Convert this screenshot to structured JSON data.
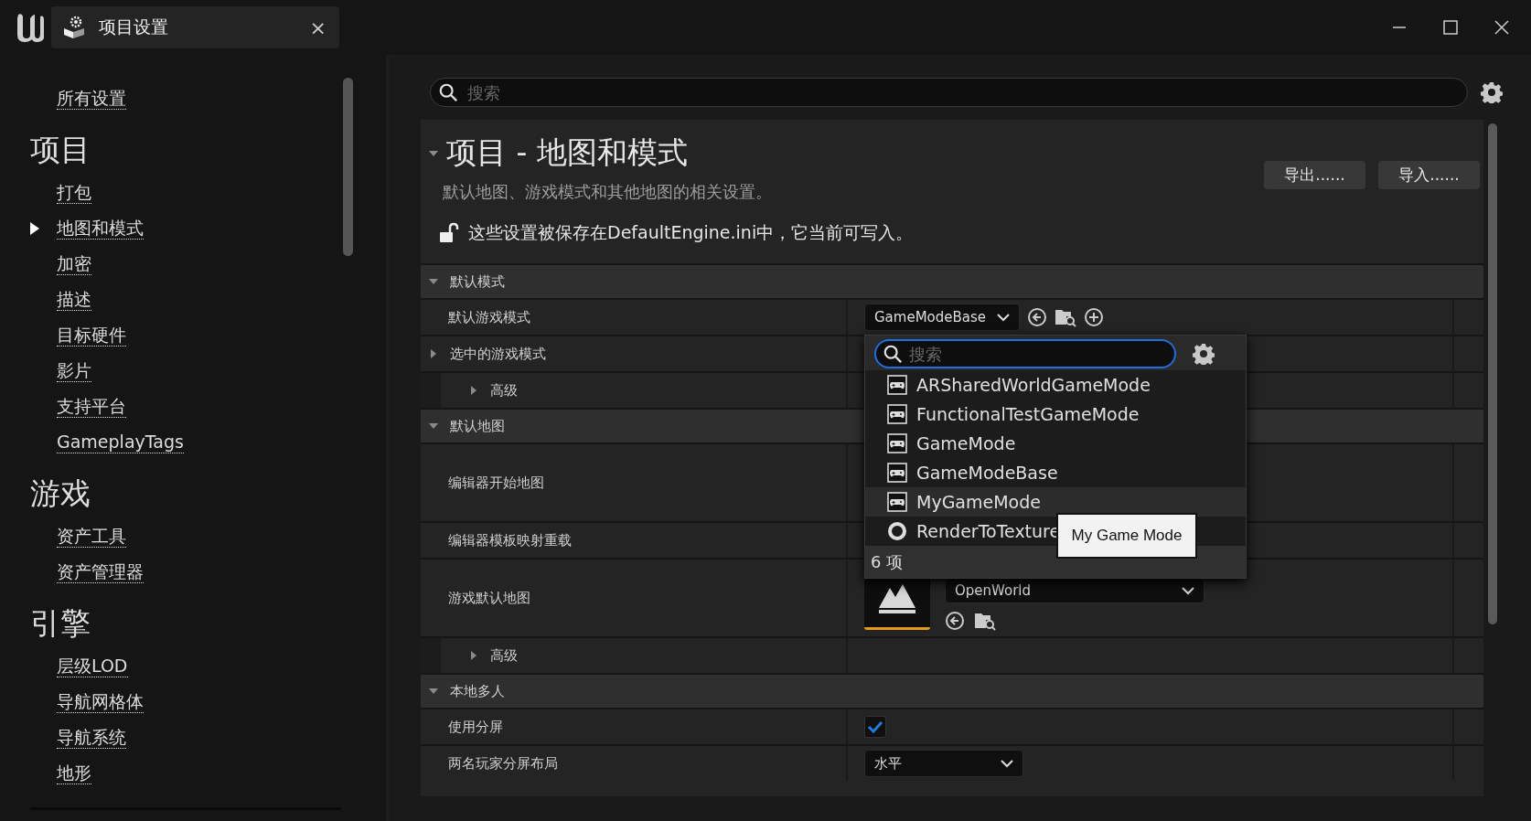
{
  "title_bar": {
    "tab": {
      "title": "项目设置",
      "close": "×"
    }
  },
  "sidebar": {
    "all_settings": {
      "label": "所有设置",
      "selected": false
    },
    "sections": [
      {
        "title": "项目",
        "items": [
          {
            "label": "打包",
            "selected": false
          },
          {
            "label": "地图和模式",
            "selected": true
          },
          {
            "label": "加密",
            "selected": false
          },
          {
            "label": "描述",
            "selected": false
          },
          {
            "label": "目标硬件",
            "selected": false
          },
          {
            "label": "影片",
            "selected": false
          },
          {
            "label": "支持平台",
            "selected": false
          },
          {
            "label": "GameplayTags",
            "selected": false
          }
        ]
      },
      {
        "title": "游戏",
        "items": [
          {
            "label": "资产工具",
            "selected": false
          },
          {
            "label": "资产管理器",
            "selected": false
          }
        ]
      },
      {
        "title": "引擎",
        "items": [
          {
            "label": "层级LOD",
            "selected": false
          },
          {
            "label": "导航网格体",
            "selected": false
          },
          {
            "label": "导航系统",
            "selected": false
          },
          {
            "label": "地形",
            "selected": false
          }
        ]
      }
    ]
  },
  "search": {
    "placeholder": "搜索"
  },
  "section": {
    "title": "项目 - 地图和模式",
    "expanded": true,
    "description": "默认地图、游戏模式和其他地图的相关设置。",
    "buttons": [
      "导出......",
      "导入......"
    ],
    "notice": "这些设置被保存在DefaultEngine.ini中，它当前可写入。"
  },
  "properties": [
    {
      "kind": "category",
      "label": "默认模式",
      "expanded": true
    },
    {
      "kind": "property",
      "label": "默认游戏模式",
      "editor": {
        "kind": "class-picker",
        "value": "GameModeBase"
      }
    },
    {
      "kind": "property",
      "label": "选中的游戏模式",
      "expanded": false
    },
    {
      "kind": "subgroup",
      "label": "高级",
      "expanded": false
    },
    {
      "kind": "category",
      "label": "默认地图",
      "expanded": true
    },
    {
      "kind": "asset-property",
      "label": "编辑器开始地图"
    },
    {
      "kind": "property",
      "label": "编辑器模板映射重载"
    },
    {
      "kind": "asset-property",
      "label": "游戏默认地图",
      "editor": {
        "kind": "map-picker",
        "value": "OpenWorld"
      }
    },
    {
      "kind": "subgroup",
      "label": "高级",
      "expanded": false
    },
    {
      "kind": "category",
      "label": "本地多人",
      "expanded": true
    },
    {
      "kind": "property",
      "label": "使用分屏",
      "editor": {
        "kind": "checkbox",
        "checked": true
      }
    },
    {
      "kind": "property",
      "label": "两名玩家分屏布局",
      "editor": {
        "kind": "combo",
        "value": "水平"
      }
    }
  ],
  "class_popup": {
    "placeholder": "搜索",
    "items": [
      {
        "label": "ARSharedWorldGameMode",
        "kind": "game-mode",
        "selected": false
      },
      {
        "label": "FunctionalTestGameMode",
        "kind": "game-mode",
        "selected": false
      },
      {
        "label": "GameMode",
        "kind": "game-mode",
        "selected": false
      },
      {
        "label": "GameModeBase",
        "kind": "game-mode",
        "selected": false
      },
      {
        "label": "MyGameMode",
        "kind": "game-mode",
        "selected": true
      },
      {
        "label": "RenderToTexture",
        "kind": "render-target",
        "selected": false
      }
    ],
    "count": "6 项",
    "tooltip": "My Game Mode"
  }
}
